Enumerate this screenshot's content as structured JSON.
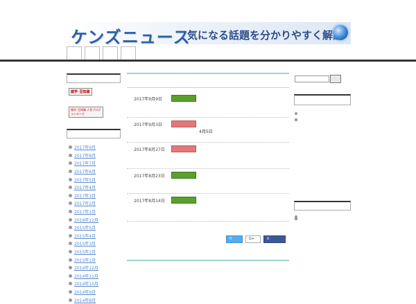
{
  "header": {
    "top_link": "",
    "tagline": "",
    "logo": "ケンズニュース",
    "banner_sub": "気になる話題を分かりやすく解説"
  },
  "nav": [
    "",
    "",
    "",
    ""
  ],
  "left": {
    "categories_title": "",
    "badge1": "雑学･豆知識",
    "badge1_link": "",
    "badge2": "雑学･豆知識 人気ブログランキング",
    "badge2_link": "",
    "archive_title": "",
    "archives": [
      "2017年9月",
      "2017年8月",
      "2017年7月",
      "2017年6月",
      "2017年5月",
      "2017年4月",
      "2017年3月",
      "2017年2月",
      "2017年1月",
      "2016年12月",
      "2015年5月",
      "2015年4月",
      "2015年3月",
      "2015年2月",
      "2015年1月",
      "2014年12月",
      "2014年11月",
      "2014年10月",
      "2014年9月",
      "2014年8月"
    ]
  },
  "main": {
    "heading": "",
    "news": [
      {
        "date": "2017年9月9日",
        "tag": "",
        "tag_color": "green",
        "title": "",
        "body": ""
      },
      {
        "date": "2017年9月3日",
        "tag": "",
        "tag_color": "red",
        "title": "",
        "body": "4月5日"
      },
      {
        "date": "2017年8月27日",
        "tag": "",
        "tag_color": "red",
        "title": "",
        "body": ""
      },
      {
        "date": "2017年8月23日",
        "tag": "",
        "tag_color": "green",
        "title": "",
        "body": ""
      },
      {
        "date": "2017年8月14日",
        "tag": "",
        "tag_color": "green",
        "title": "",
        "body": ""
      }
    ],
    "share_label": "",
    "tweet_count": "0",
    "gplus": "G+",
    "fb": "0",
    "bottom_link": ""
  },
  "right": {
    "search_btn": "",
    "recent_title": "",
    "recent": [
      "",
      "",
      "",
      "",
      ""
    ],
    "cat_title": "",
    "cats": [
      "",
      "",
      "",
      "",
      "",
      "",
      "",
      "",
      ""
    ]
  },
  "colors": {
    "accent": "#2d5fa8",
    "tag_green": "#5aa02c",
    "tag_red": "#e07a7a",
    "rule": "#9fd0dc"
  }
}
